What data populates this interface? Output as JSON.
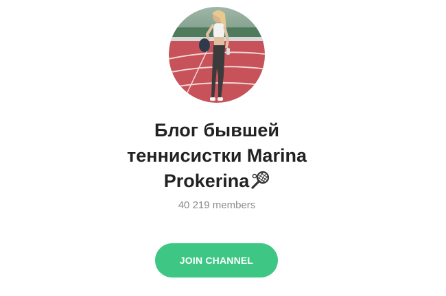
{
  "channel": {
    "title_line1": "Блог бывшей",
    "title_line2": "теннисистки Marina",
    "title_line3": "Prokerina",
    "racket_emoji": "tennis-racket-icon",
    "members": "40 219 members",
    "avatar": "channel-avatar"
  },
  "actions": {
    "join_label": "JOIN CHANNEL"
  },
  "colors": {
    "accent": "#3ec784",
    "title": "#222222",
    "muted": "#8a8a8a",
    "track": "#c7525a"
  }
}
